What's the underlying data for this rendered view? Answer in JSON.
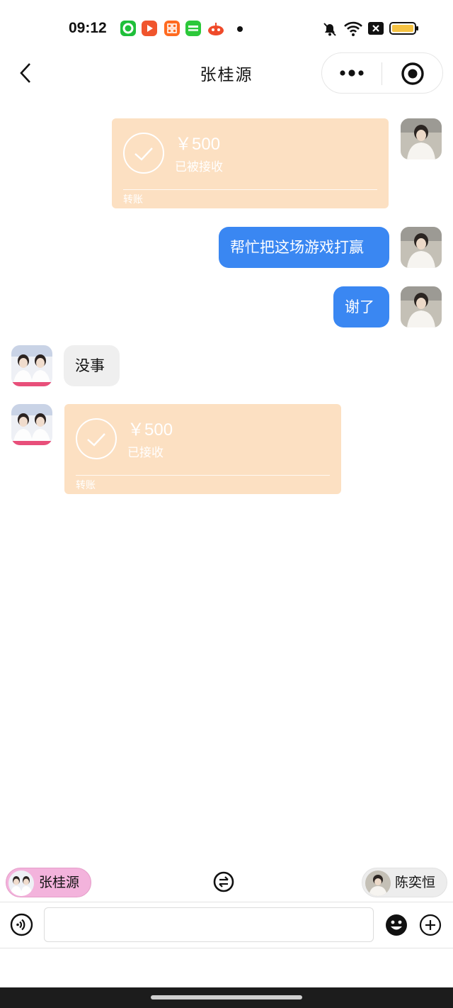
{
  "status_bar": {
    "time": "09:12",
    "app_icons": [
      "green-circle-app-icon",
      "red-play-app-icon",
      "orange-grid-app-icon",
      "iqiyi-app-icon",
      "red-robot-app-icon"
    ],
    "right_icons": [
      "muted-bell-icon",
      "wifi-icon",
      "close-box-icon",
      "battery-icon"
    ],
    "colors": {
      "battery": "#f5c242"
    }
  },
  "header": {
    "title": "张桂源",
    "back_icon": "chevron-left-icon",
    "more_icon": "more-dots-icon",
    "close_icon": "target-circle-icon"
  },
  "messages": [
    {
      "side": "right",
      "type": "transfer",
      "amount": "￥500",
      "state": "已被接收",
      "label": "转账"
    },
    {
      "side": "right",
      "type": "text",
      "text": "帮忙把这场游戏打赢"
    },
    {
      "side": "right",
      "type": "text",
      "text": "谢了"
    },
    {
      "side": "left",
      "type": "text",
      "text": "没事"
    },
    {
      "side": "left",
      "type": "transfer",
      "amount": "￥500",
      "state": "已接收",
      "label": "转账"
    }
  ],
  "roles": {
    "left": {
      "name": "张桂源",
      "color": "#f3b3dc"
    },
    "right": {
      "name": "陈奕恒",
      "color": "#ededed"
    },
    "switch_icon": "swap-arrows-icon"
  },
  "input_bar": {
    "placeholder": "",
    "voice_icon": "voice-icon",
    "emoji_icon": "emoji-icon",
    "plus_icon": "plus-circle-icon"
  },
  "colors": {
    "blue_bubble": "#3a87f2",
    "gray_bubble": "#efefef",
    "transfer_card": "#fce0c2"
  }
}
